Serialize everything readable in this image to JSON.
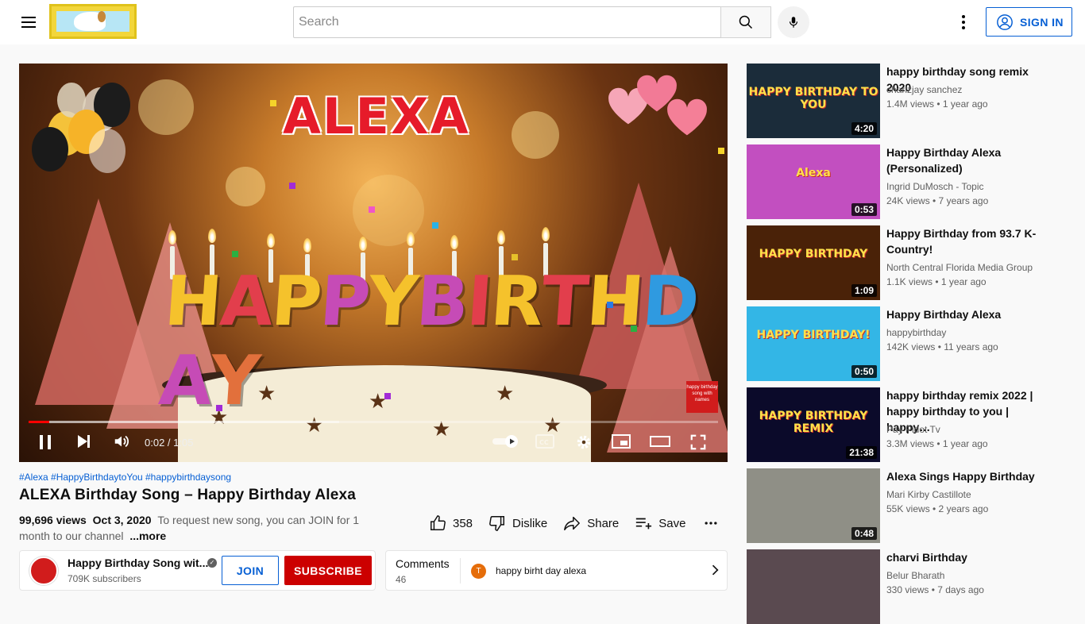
{
  "header": {
    "search_placeholder": "Search",
    "signin_label": "SIGN IN"
  },
  "player": {
    "overlay_name": "ALEXA",
    "overlay_greeting": [
      "H",
      "A",
      "P",
      "P",
      "Y",
      " ",
      "B",
      "I",
      "R",
      "T",
      "H",
      "D",
      "A",
      "Y"
    ],
    "watermark": "happy birthday song with names",
    "time_current": "0:02",
    "time_total": "1:05",
    "time_display": "0:02 / 1:05",
    "progress_fraction": 0.03,
    "buffered_fraction": 0.45
  },
  "video": {
    "hashtags": "#Alexa #HappyBirthdaytoYou #happybirthdaysong",
    "title": "ALEXA Birthday Song – Happy Birthday Alexa",
    "views": "99,696 views",
    "date": "Oct 3, 2020",
    "desc_line1": "To request new song, you can JOIN for 1",
    "desc_line2": "month to our channel",
    "more_label": "...more",
    "likes": "358",
    "dislike_label": "Dislike",
    "share_label": "Share",
    "save_label": "Save"
  },
  "channel": {
    "name": "Happy Birthday Song wit...",
    "subscribers": "709K subscribers",
    "join_label": "JOIN",
    "subscribe_label": "SUBSCRIBE",
    "avatar_text": "happy birthday song with names"
  },
  "comments": {
    "label": "Comments",
    "count": "46",
    "avatar_letter": "T",
    "preview": "happy birht day alexa"
  },
  "recommendations": [
    {
      "title": "happy birthday song remix 2020",
      "channel": "charlzjay sanchez",
      "meta": "1.4M views • 1 year ago",
      "duration": "4:20",
      "thumb_text": "HAPPY BIRTHDAY TO YOU",
      "color": "#1b2c3a"
    },
    {
      "title": "Happy Birthday Alexa (Personalized)",
      "channel": "Ingrid DuMosch - Topic",
      "meta": "24K views • 7 years ago",
      "duration": "0:53",
      "thumb_text": "Alexa",
      "color": "#c24fc0"
    },
    {
      "title": "Happy Birthday from 93.7 K-Country!",
      "channel": "North Central Florida Media Group",
      "meta": "1.1K views • 1 year ago",
      "duration": "1:09",
      "thumb_text": "HAPPY BIRTHDAY",
      "color": "#4a2208"
    },
    {
      "title": "Happy Birthday Alexa",
      "channel": "happybirthday",
      "meta": "142K views • 11 years ago",
      "duration": "0:50",
      "thumb_text": "HAPPY BIRTHDAY!",
      "color": "#33b6e6"
    },
    {
      "title": "happy birthday remix 2022 | happy birthday to you | happy…",
      "channel": "Pay Pidot Tv",
      "meta": "3.3M views • 1 year ago",
      "duration": "21:38",
      "thumb_text": "HAPPY BIRTHDAY REMIX",
      "color": "#0b0a2a"
    },
    {
      "title": "Alexa Sings Happy Birthday",
      "channel": "Mari Kirby Castillote",
      "meta": "55K views • 2 years ago",
      "duration": "0:48",
      "thumb_text": "",
      "color": "#8f8f86"
    },
    {
      "title": "charvi Birthday",
      "channel": "Belur Bharath",
      "meta": "330 views • 7 days ago",
      "duration": "",
      "thumb_text": "",
      "color": "#5a4a50"
    }
  ]
}
